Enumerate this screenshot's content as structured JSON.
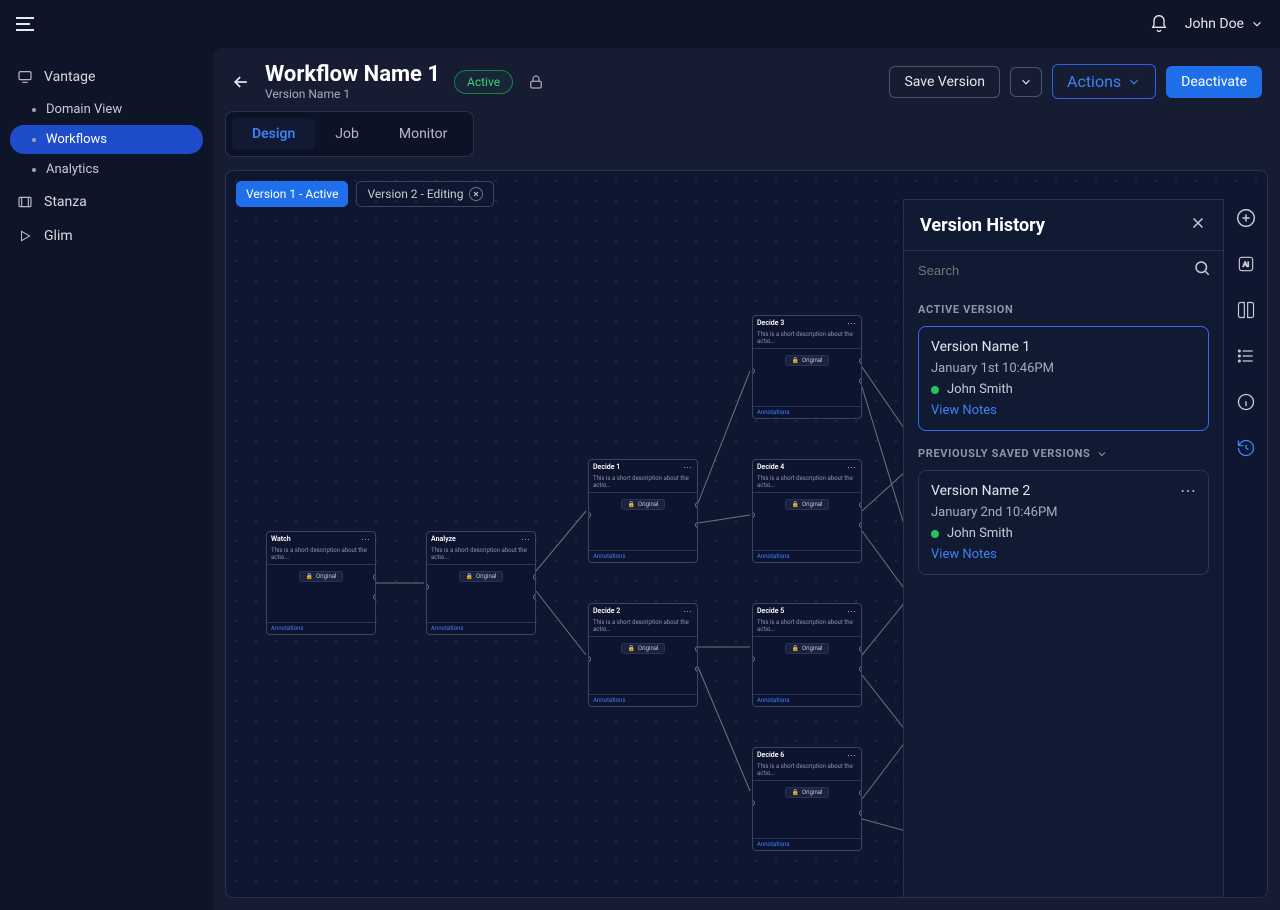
{
  "user": {
    "name": "John Doe"
  },
  "sidebar": {
    "vantage": "Vantage",
    "items": {
      "domain": "Domain View",
      "workflows": "Workflows",
      "analytics": "Analytics"
    },
    "stanza": "Stanza",
    "glim": "Glim"
  },
  "workflow": {
    "title": "Workflow Name 1",
    "versionLabel": "Version Name 1",
    "status": "Active"
  },
  "actions": {
    "save": "Save Version",
    "actions": "Actions",
    "deactivate": "Deactivate"
  },
  "tabs": {
    "design": "Design",
    "job": "Job",
    "monitor": "Monitor"
  },
  "chips": {
    "v1": "Version 1 - Active",
    "v2": "Version 2 - Editing"
  },
  "history": {
    "title": "Version History",
    "searchPlaceholder": "Search",
    "activeLabel": "ACTIVE VERSION",
    "prevLabel": "PREVIOUSLY SAVED VERSIONS",
    "viewNotes": "View Notes",
    "cards": [
      {
        "name": "Version Name 1",
        "date": "January 1st 10:46PM",
        "user": "John Smith"
      },
      {
        "name": "Version Name 2",
        "date": "January 2nd 10:46PM",
        "user": "John Smith"
      }
    ]
  },
  "nodes": {
    "desc": "This is a short description about the actio...",
    "original": "Original",
    "annotations": "Annotations",
    "watch": "Watch",
    "analyze": "Analyze",
    "decide1": "Decide 1",
    "decide2": "Decide 2",
    "decide3": "Decide 3",
    "decide4": "Decide 4",
    "decide5": "Decide 5",
    "decide6": "Decide 6"
  }
}
